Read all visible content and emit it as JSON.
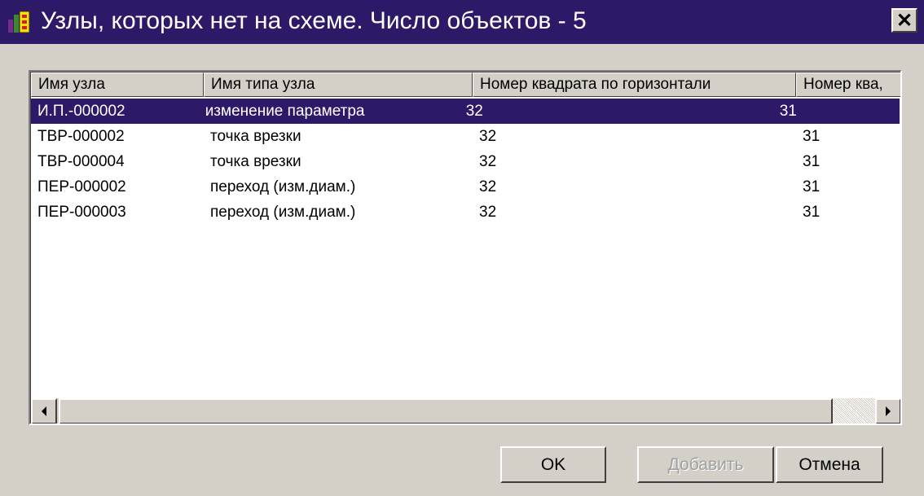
{
  "window": {
    "title": "Узлы, которых нет на схеме. Число объектов - 5",
    "close_glyph": "✕"
  },
  "list": {
    "columns": [
      "Имя узла",
      "Имя типа узла",
      "Номер квадрата по горизонтали",
      "Номер ква,"
    ],
    "rows": [
      {
        "name": "И.П.-000002",
        "type": "изменение параметра",
        "h": "32",
        "v": "31",
        "selected": true
      },
      {
        "name": "ТВР-000002",
        "type": "точка врезки",
        "h": "32",
        "v": "31",
        "selected": false
      },
      {
        "name": "ТВР-000004",
        "type": "точка врезки",
        "h": "32",
        "v": "31",
        "selected": false
      },
      {
        "name": "ПЕР-000002",
        "type": "переход (изм.диам.)",
        "h": "32",
        "v": "31",
        "selected": false
      },
      {
        "name": "ПЕР-000003",
        "type": "переход (изм.диам.)",
        "h": "32",
        "v": "31",
        "selected": false
      }
    ]
  },
  "buttons": {
    "ok": "OK",
    "add": "Добавить",
    "cancel": "Отмена"
  },
  "colors": {
    "title_bar": "#2c1a68",
    "selection": "#2c1a68",
    "face": "#d4d0c8"
  },
  "icons": {
    "app": "app-icon",
    "close": "close-icon",
    "scroll_left": "arrow-left-icon",
    "scroll_right": "arrow-right-icon"
  }
}
